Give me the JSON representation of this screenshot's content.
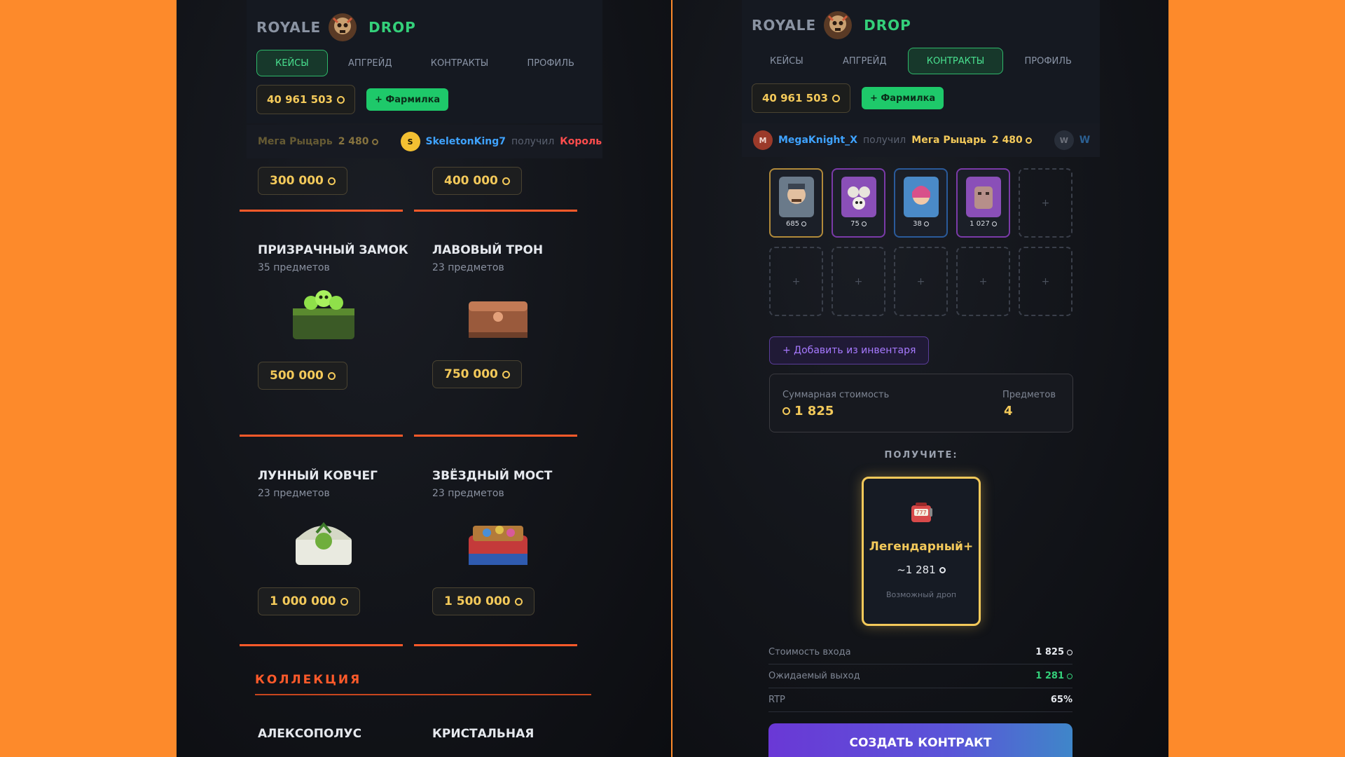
{
  "brand": {
    "left": "ROYALE",
    "right": "DROP"
  },
  "left": {
    "tabs": [
      {
        "label": "КЕЙСЫ",
        "active": true
      },
      {
        "label": "АПГРЕЙД",
        "active": false
      },
      {
        "label": "КОНТРАКТЫ",
        "active": false
      },
      {
        "label": "ПРОФИЛЬ",
        "active": false
      }
    ],
    "balance": "40 961 503",
    "farm_label": "+ Фармилка",
    "ticker": {
      "prize_name": "Мега Рыцарь",
      "prize_price": "2 480",
      "user_initial": "S",
      "user": "SkeletonKing7",
      "verb": "получил",
      "user_prize": "Король Ске"
    },
    "top_prices": [
      "300 000",
      "400 000"
    ],
    "cases": [
      {
        "title": "ПРИЗРАЧНЫЙ ЗАМОК",
        "count": "35 предметов",
        "price": "500 000"
      },
      {
        "title": "ЛАВОВЫЙ ТРОН",
        "count": "23 предметов",
        "price": "750 000"
      },
      {
        "title": "ЛУННЫЙ КОВЧЕГ",
        "count": "23 предметов",
        "price": "1 000 000"
      },
      {
        "title": "ЗВЁЗДНЫЙ МОСТ",
        "count": "23 предметов",
        "price": "1 500 000"
      }
    ],
    "section_title": "КОЛЛЕКЦИЯ",
    "collection": [
      "АЛЕКСОПОЛУС",
      "КРИСТАЛЬНАЯ"
    ]
  },
  "right": {
    "tabs": [
      {
        "label": "КЕЙСЫ",
        "active": false
      },
      {
        "label": "АПГРЕЙД",
        "active": false
      },
      {
        "label": "КОНТРАКТЫ",
        "active": true
      },
      {
        "label": "ПРОФИЛЬ",
        "active": false
      }
    ],
    "balance": "40 961 503",
    "farm_label": "+ Фармилка",
    "ticker": {
      "user_initial": "M",
      "user": "MegaKnight_X",
      "verb": "получил",
      "prize_name": "Мега Рыцарь",
      "prize_price": "2 480",
      "next_initial": "W",
      "next_user": "W"
    },
    "slot_values": [
      "685",
      "75",
      "38",
      "1 027"
    ],
    "empty_slot_glyph": "+",
    "add_inventory": "+ Добавить из инвентаря",
    "sum_label": "Суммарная стоимость",
    "sum_value": "1 825",
    "items_label": "Предметов",
    "items_value": "4",
    "receive_label": "ПОЛУЧИТЕ:",
    "reward": {
      "icon": "slot-machine-icon",
      "title": "Легендарный+",
      "value": "~1 281",
      "subtitle": "Возможный дроп"
    },
    "stats": [
      {
        "label": "Стоимость входа",
        "value": "1 825",
        "coin": true
      },
      {
        "label": "Ожидаемый выход",
        "value": "1 281",
        "coin": true,
        "accent": "#34d07a"
      },
      {
        "label": "RTP",
        "value": "65%"
      }
    ],
    "create_label": "СОЗДАТЬ КОНТРАКТ"
  }
}
